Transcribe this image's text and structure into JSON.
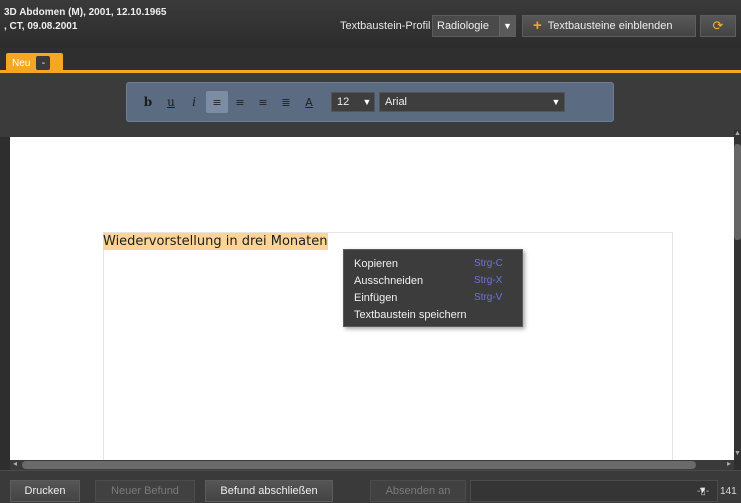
{
  "header": {
    "patient_line1": "3D Abdomen (M), 2001, 12.10.1965",
    "patient_line2": ", CT, 09.08.2001",
    "profile_label": "Textbaustein-Profil",
    "profile_value": "Radiologie",
    "show_button": "Textbausteine einblenden"
  },
  "tabs": {
    "active_label": "Neu",
    "close_symbol": "-"
  },
  "toolbar": {
    "bold": "b",
    "underline": "u",
    "italic": "i",
    "text_color": "A",
    "font_size": "12",
    "font_name": "Arial"
  },
  "document": {
    "text": "Wiedervorstellung in drei Monaten"
  },
  "context_menu": {
    "items": [
      {
        "label": "Kopieren",
        "shortcut": "Strg-C"
      },
      {
        "label": "Ausschneiden",
        "shortcut": "Strg-X"
      },
      {
        "label": "Einfügen",
        "shortcut": "Strg-V"
      },
      {
        "label": "Textbaustein speichern",
        "shortcut": ""
      }
    ]
  },
  "bottom": {
    "print": "Drucken",
    "new_report": "Neuer Befund",
    "finish_report": "Befund abschließen",
    "send_to": "Absenden an",
    "zoom_value": "141"
  },
  "colors": {
    "accent": "#f5a623",
    "toolbar_bg": "#5b6b82",
    "highlight": "#fcd497",
    "shortcut_text": "#6f72d6"
  }
}
